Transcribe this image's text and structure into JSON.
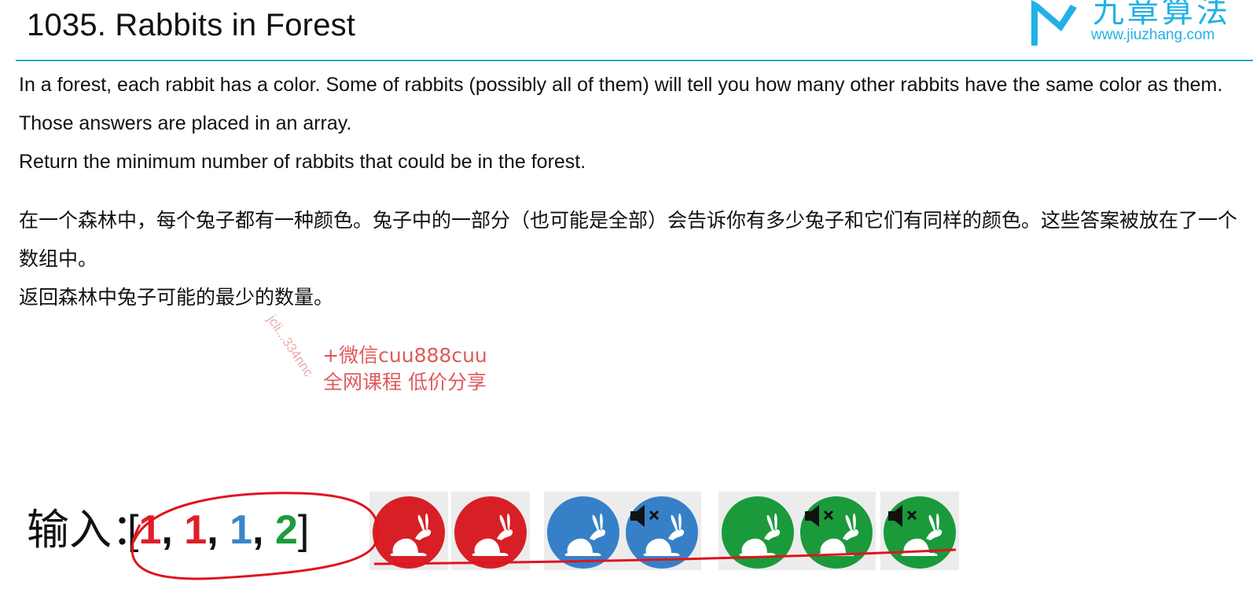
{
  "header": {
    "title": "1035. Rabbits in Forest"
  },
  "logo": {
    "name": "九章算法",
    "url": "www.jiuzhang.com",
    "icon": "jiuzhang-logo-icon"
  },
  "description": {
    "en_line1": "In a forest, each rabbit has a color. Some of rabbits (possibly all of them) will tell you how many other rabbits have the same color as them. Those answers are placed in an array.",
    "en_line2": "Return the minimum number of rabbits that could be in the forest.",
    "zh_line1": "在一个森林中，每个兔子都有一种颜色。兔子中的一部分（也可能是全部）会告诉你有多少兔子和它们有同样的颜色。这些答案被放在了一个数组中。",
    "zh_line2": "返回森林中兔子可能的最少的数量。"
  },
  "watermark": {
    "diagonal": "jcli...334nnc",
    "line1": "+微信cuu888cuu",
    "line2": "全网课程 低价分享"
  },
  "example": {
    "label": "输入：",
    "open_bracket": "[",
    "close_bracket": "]",
    "values": [
      "1",
      "1",
      "1",
      "2"
    ],
    "colors": [
      "#e01e2b",
      "#e01e2b",
      "#3b86c8",
      "#1e9b3c"
    ]
  },
  "rabbits": [
    {
      "color": "#d81f26",
      "muted": false,
      "icon": "rabbit-icon"
    },
    {
      "color": "#d81f26",
      "muted": false,
      "icon": "rabbit-icon"
    },
    {
      "color": "#3680c8",
      "muted": false,
      "icon": "rabbit-icon"
    },
    {
      "color": "#3680c8",
      "muted": true,
      "icon": "rabbit-icon"
    },
    {
      "color": "#1a9a3b",
      "muted": false,
      "icon": "rabbit-icon"
    },
    {
      "color": "#1a9a3b",
      "muted": true,
      "icon": "rabbit-icon"
    },
    {
      "color": "#1a9a3b",
      "muted": true,
      "icon": "rabbit-icon"
    }
  ],
  "colors": {
    "accent_rule": "#2aa4d8",
    "annotation_ink": "#e0141e"
  }
}
